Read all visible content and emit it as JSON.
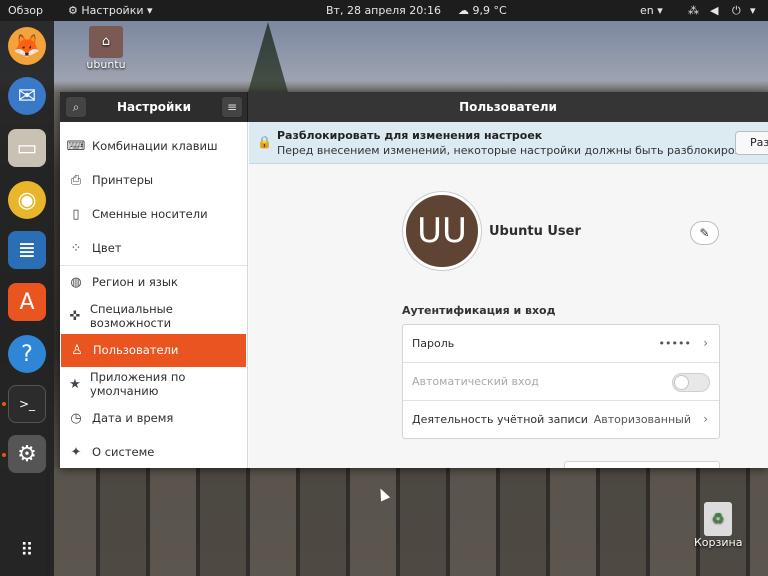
{
  "topbar": {
    "activities": "Обзор",
    "app_menu": "Настройки",
    "clock": "Вт, 28 апреля  20:16",
    "weather": "9,9 °C",
    "language": "en"
  },
  "desktop": {
    "home_icon_label": "ubuntu",
    "trash_label": "Корзина"
  },
  "window": {
    "sidebar_title": "Настройки",
    "content_title": "Пользователи",
    "sidebar_items": [
      {
        "label": "Комбинации клавиш",
        "icon": "keyboard-icon"
      },
      {
        "label": "Принтеры",
        "icon": "printer-icon"
      },
      {
        "label": "Сменные носители",
        "icon": "removable-media-icon"
      },
      {
        "label": "Цвет",
        "icon": "color-icon"
      },
      {
        "label": "Регион и язык",
        "icon": "globe-icon"
      },
      {
        "label": "Специальные возможности",
        "icon": "accessibility-icon"
      },
      {
        "label": "Пользователи",
        "icon": "user-icon"
      },
      {
        "label": "Приложения по умолчанию",
        "icon": "star-icon"
      },
      {
        "label": "Дата и время",
        "icon": "clock-icon"
      },
      {
        "label": "О системе",
        "icon": "sparkle-icon"
      }
    ],
    "active_item": "Пользователи"
  },
  "banner": {
    "title": "Разблокировать для изменения настроек",
    "subtitle": "Перед внесением изменений, некоторые настройки должны быть разблокированы",
    "unlock_button": "Раз"
  },
  "user": {
    "initials": "UU",
    "name": "Ubuntu User"
  },
  "auth": {
    "section_title": "Аутентификация и вход",
    "password_label": "Пароль",
    "password_value": "•••••",
    "autologin_label": "Автоматический вход",
    "autologin_enabled": false,
    "account_activity_label": "Деятельность учётной записи",
    "account_activity_value": "Авторизованный"
  },
  "colors": {
    "accent": "#e95420",
    "avatar": "#5f4433"
  }
}
